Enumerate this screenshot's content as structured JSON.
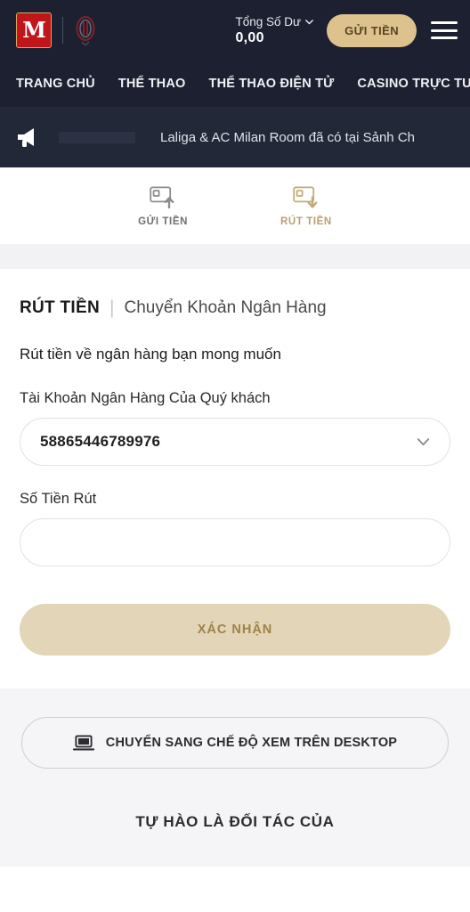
{
  "header": {
    "logo_text": "M",
    "logo_alt": "millionaire-logo",
    "crest_alt": "ac-milan-crest",
    "balance_label": "Tổng Số Dư",
    "balance_value": "0,00",
    "deposit_button": "GỬI TIỀN",
    "menu_alt": "hamburger-menu",
    "bg_color": "#1c2030",
    "accent_color": "#ddc28d"
  },
  "nav": {
    "items": [
      {
        "label": "TRANG CHỦ"
      },
      {
        "label": "THỂ THAO"
      },
      {
        "label": "THỂ THAO ĐIỆN TỬ"
      },
      {
        "label": "CASINO TRỰC TUYẾN"
      }
    ]
  },
  "marquee": {
    "icon": "megaphone-icon",
    "text": "Laliga & AC Milan Room đã có tại Sảnh Ch"
  },
  "tabs": [
    {
      "label": "GỬI TIỀN",
      "icon": "wallet-up-icon",
      "active": false,
      "color": "#707070"
    },
    {
      "label": "RÚT TIỀN",
      "icon": "wallet-down-icon",
      "active": true,
      "color": "#b99f6b"
    }
  ],
  "form": {
    "title_strong": "RÚT TIỀN",
    "title_separator": "|",
    "title_light": "Chuyển Khoản Ngân Hàng",
    "subtitle": "Rút tiền về ngân hàng bạn mong muốn",
    "bank_account": {
      "label": "Tài Khoản Ngân Hàng Của Quý khách",
      "value": "58865446789976",
      "placeholder": "",
      "chevron": "chevron-down-icon"
    },
    "amount": {
      "label": "Số Tiền Rút",
      "value": "",
      "placeholder": ""
    },
    "confirm_button": "XÁC NHẬN",
    "confirm_bg": "#e3d5b7",
    "confirm_text_color": "#9c8347"
  },
  "footer": {
    "desktop_button": "CHUYỂN SANG CHẾ ĐỘ XEM TRÊN DESKTOP",
    "desktop_icon": "laptop-icon",
    "partner_title": "TỰ HÀO LÀ ĐỐI TÁC CỦA"
  }
}
